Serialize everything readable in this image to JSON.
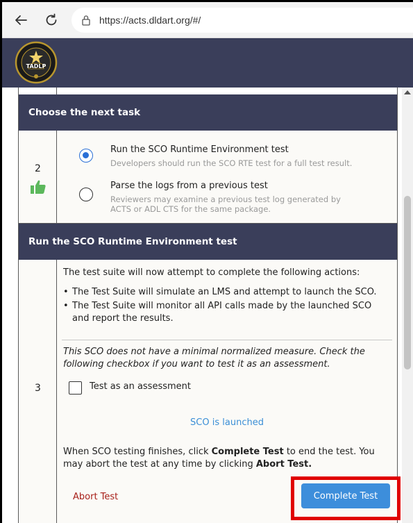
{
  "browser": {
    "url": "https://acts.dldart.org/#/"
  },
  "header": {
    "logo_text": "TADLP"
  },
  "section_next_task": {
    "title": "Choose the next task",
    "step_number": "2",
    "options": [
      {
        "title": "Run the SCO Runtime Environment test",
        "description": "Developers should run the SCO RTE test for a full test result.",
        "selected": true
      },
      {
        "title": "Parse the logs from a previous test",
        "description_lines": [
          "Reviewers may examine a previous test log generated by",
          "ACTS or ADL CTS for the same package."
        ],
        "selected": false
      }
    ]
  },
  "section_rte": {
    "title": "Run the SCO Runtime Environment test",
    "step_number": "3",
    "intro": "The test suite will now attempt to complete the following actions:",
    "bullets": [
      "The Test Suite will simulate an LMS and attempt to launch the SCO.",
      "The Test Suite will monitor all API calls made by the launched SCO and report the results."
    ],
    "measure_note_lines": [
      "This SCO does not have a minimal normalized measure. Check the",
      "following checkbox if you want to test it as an assessment."
    ],
    "checkbox_label": "Test as an assessment",
    "checkbox_checked": false,
    "status": "SCO is launched",
    "finish_text": {
      "part1": "When SCO testing finishes, click ",
      "bold1": "Complete Test",
      "part2": " to end the test. You may abort the test at any time by clicking ",
      "bold2": "Abort Test."
    },
    "abort_label": "Abort Test",
    "complete_label": "Complete Test"
  },
  "colors": {
    "header_bg": "#3a3e5a",
    "accent_blue": "#3d8edb",
    "abort_red": "#a8201a",
    "highlight_red": "#e00000"
  }
}
